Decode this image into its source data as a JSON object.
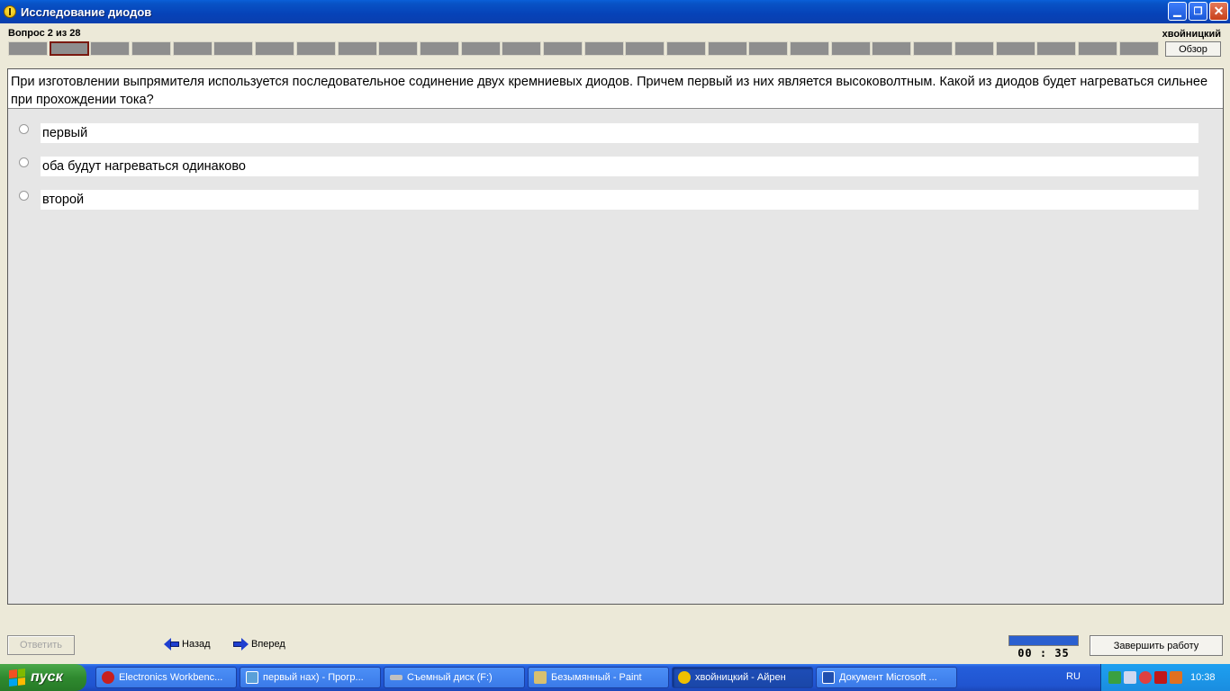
{
  "window": {
    "title": "Исследование диодов",
    "icon": "app-coin-icon"
  },
  "header": {
    "question_counter": "Вопрос 2 из 28",
    "user_name": "хвойницкий",
    "overview_label": "Обзор",
    "total_questions": 28,
    "current_question": 2
  },
  "question": {
    "text": "При изготовлении выпрямителя используется последовательное содинение двух кремниевых диодов. Причем первый из них является высоковолтным. Какой из диодов будет нагреваться сильнее при прохождении тока?"
  },
  "answers": [
    {
      "label": "первый",
      "selected": false
    },
    {
      "label": "оба будут нагреваться одинаково",
      "selected": false
    },
    {
      "label": "второй",
      "selected": false
    }
  ],
  "controls": {
    "submit_label": "Ответить",
    "back_label": "Назад",
    "forward_label": "Вперед",
    "timer": "00 : 35",
    "timer_fraction": 1.0,
    "finish_label": "Завершить работу"
  },
  "taskbar": {
    "start_label": "пуск",
    "items": [
      {
        "label": "Electronics Workbenc...",
        "icon": "workbench-icon"
      },
      {
        "label": "первый нах) - Прогр...",
        "icon": "image-viewer-icon"
      },
      {
        "label": "Съемный диск (F:)",
        "icon": "drive-icon"
      },
      {
        "label": "Безымянный - Paint",
        "icon": "paint-icon"
      },
      {
        "label": "хвойницкий - Айрен",
        "icon": "app-coin-icon",
        "active": true
      },
      {
        "label": "Документ Microsoft ...",
        "icon": "word-icon"
      }
    ],
    "language": "RU",
    "clock": "10:38"
  },
  "colors": {
    "titlebar_blue": "#0853c6",
    "progress_current_border": "#7a1a10",
    "timer_fill": "#2a5fd0"
  }
}
